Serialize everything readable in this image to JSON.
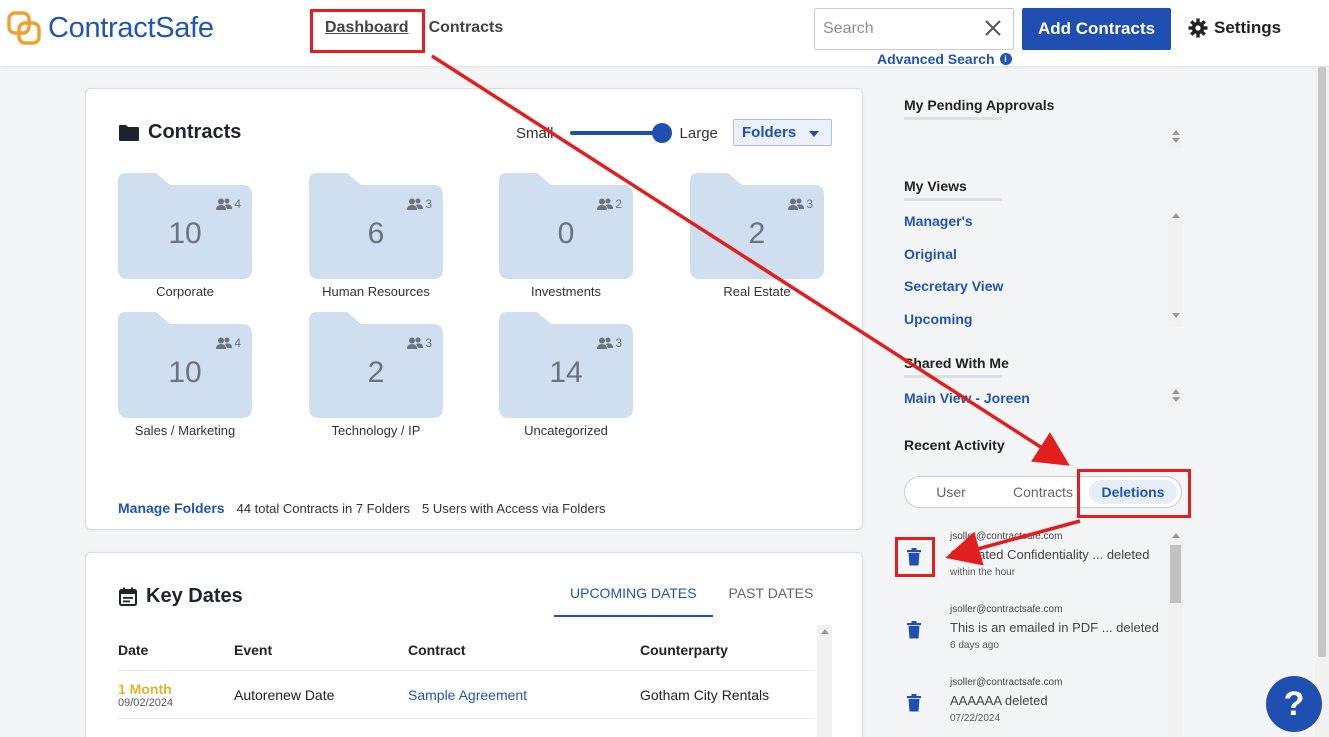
{
  "brand": {
    "name": "ContractSafe"
  },
  "nav": {
    "dashboard": "Dashboard",
    "contracts": "Contracts"
  },
  "search": {
    "placeholder": "Search",
    "advanced": "Advanced Search"
  },
  "actions": {
    "add_contracts": "Add Contracts",
    "settings": "Settings"
  },
  "contracts_card": {
    "title": "Contracts",
    "size_small": "Small",
    "size_large": "Large",
    "size_level": 1.0,
    "view_select": "Folders",
    "folders": [
      {
        "name": "Corporate",
        "count": "10",
        "users": "4"
      },
      {
        "name": "Human Resources",
        "count": "6",
        "users": "3"
      },
      {
        "name": "Investments",
        "count": "0",
        "users": "2"
      },
      {
        "name": "Real Estate",
        "count": "2",
        "users": "3"
      },
      {
        "name": "Sales / Marketing",
        "count": "10",
        "users": "4"
      },
      {
        "name": "Technology / IP",
        "count": "2",
        "users": "3"
      },
      {
        "name": "Uncategorized",
        "count": "14",
        "users": "3"
      }
    ],
    "manage": "Manage Folders",
    "total_text": "44 total Contracts in 7 Folders",
    "users_text": "5 Users with Access via Folders"
  },
  "key_dates": {
    "title": "Key Dates",
    "tab_upcoming": "UPCOMING DATES",
    "tab_past": "PAST DATES",
    "columns": [
      "Date",
      "Event",
      "Contract",
      "Counterparty"
    ],
    "rows": [
      {
        "when": "1 Month",
        "date": "09/02/2024",
        "event": "Autorenew Date",
        "contract": "Sample Agreement",
        "counterparty": "Gotham City Rentals"
      }
    ]
  },
  "right_panel": {
    "pending_title": "My Pending Approvals",
    "views_title": "My Views",
    "views": [
      "Manager's",
      "Original",
      "Secretary View",
      "Upcoming"
    ],
    "shared_title": "Shared With Me",
    "shared": [
      "Main View - Joreen"
    ],
    "recent_title": "Recent Activity",
    "recent_tabs": [
      "User",
      "Contracts",
      "Deletions"
    ],
    "activity": [
      {
        "who": "jsoller@contractsafe.com",
        "what": "Outdated Confidentiality ... deleted",
        "when": "within the hour"
      },
      {
        "who": "jsoller@contractsafe.com",
        "what": "This is an emailed in PDF ... deleted",
        "when": "6 days ago"
      },
      {
        "who": "jsoller@contractsafe.com",
        "what": "AAAAAA deleted",
        "when": "07/22/2024"
      }
    ]
  },
  "help": {
    "label": "?"
  },
  "colors": {
    "brand_blue": "#1f4fb0",
    "link_blue": "#1f55b5",
    "logo_orange": "#f0a02e",
    "annotation_red": "#e21f1f",
    "folder_fill": "#cfdff0"
  }
}
